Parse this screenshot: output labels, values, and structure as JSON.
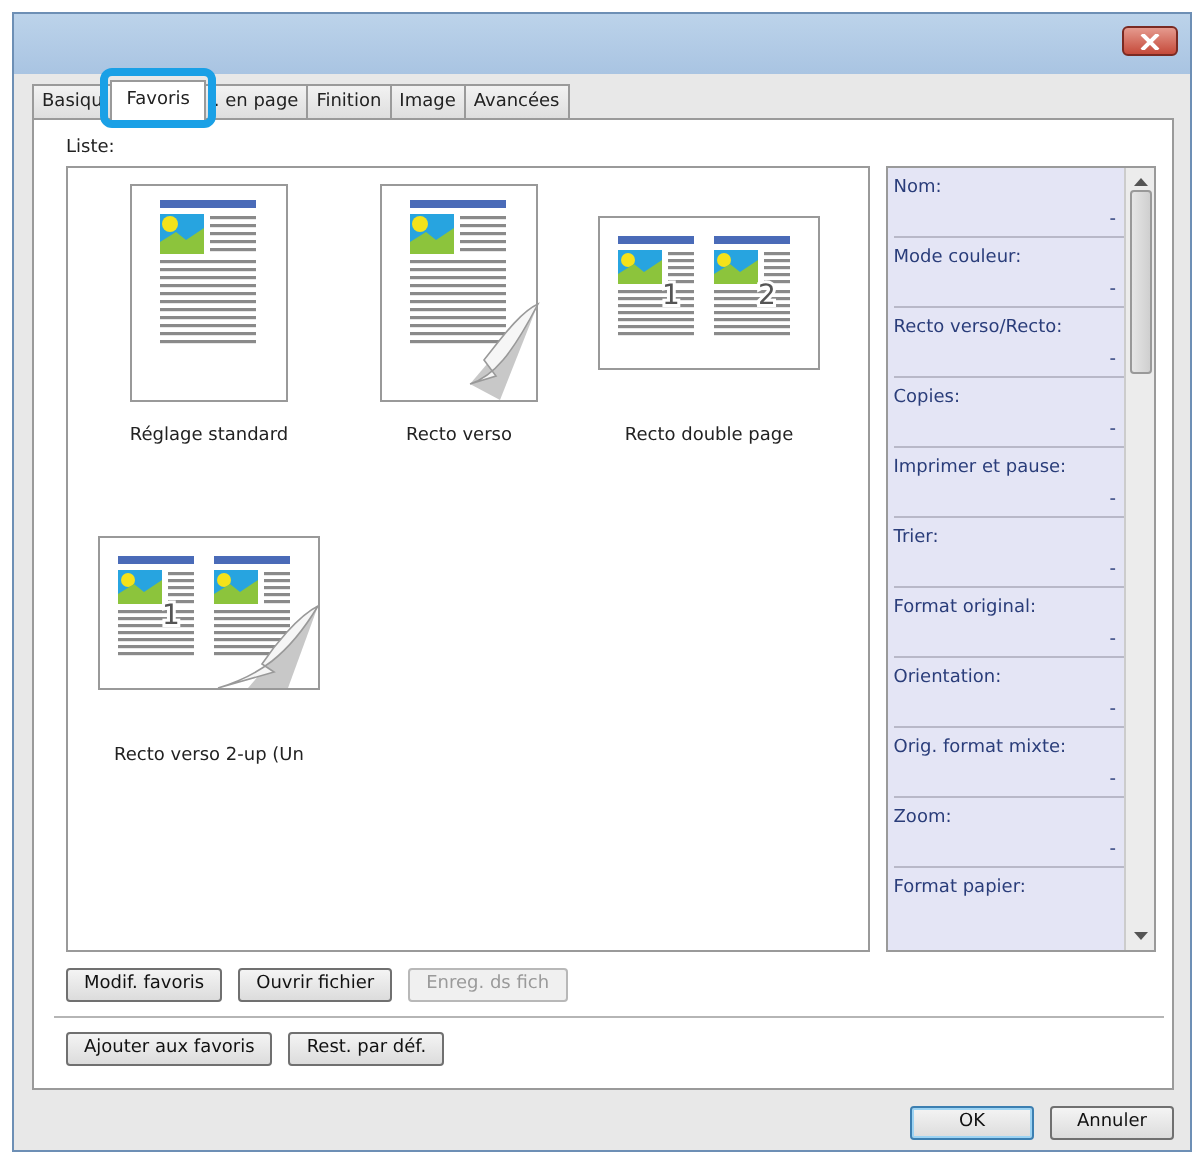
{
  "tabs": [
    {
      "label": "Basiqu",
      "selected": false
    },
    {
      "label": "Favoris",
      "selected": true
    },
    {
      "label": ". en page",
      "selected": false
    },
    {
      "label": "Finition",
      "selected": false
    },
    {
      "label": "Image",
      "selected": false
    },
    {
      "label": "Avancées",
      "selected": false
    }
  ],
  "list_label": "Liste:",
  "favorites": [
    {
      "kind": "single",
      "label": "Réglage standard"
    },
    {
      "kind": "duplex",
      "label": "Recto verso"
    },
    {
      "kind": "booklet",
      "label": "Recto double page",
      "numbers": [
        "1",
        "2"
      ]
    },
    {
      "kind": "duplex_2up",
      "label": "Recto verso 2-up (Un",
      "numbers": [
        "1"
      ]
    }
  ],
  "details": [
    {
      "label": "Nom:",
      "value": "-"
    },
    {
      "label": "Mode couleur:",
      "value": "-"
    },
    {
      "label": "Recto verso/Recto:",
      "value": "-"
    },
    {
      "label": "Copies:",
      "value": "-"
    },
    {
      "label": "Imprimer et pause:",
      "value": "-"
    },
    {
      "label": "Trier:",
      "value": "-"
    },
    {
      "label": "Format original:",
      "value": "-"
    },
    {
      "label": "Orientation:",
      "value": "-"
    },
    {
      "label": "Orig. format mixte:",
      "value": "-"
    },
    {
      "label": "Zoom:",
      "value": "-"
    },
    {
      "label": "Format papier:"
    }
  ],
  "list_buttons": [
    {
      "label": "Modif. favoris",
      "disabled": false
    },
    {
      "label": "Ouvrir fichier",
      "disabled": false
    },
    {
      "label": "Enreg. ds fich",
      "disabled": true
    }
  ],
  "favorite_buttons": [
    {
      "label": "Ajouter aux favoris",
      "disabled": false
    },
    {
      "label": "Rest. par déf.",
      "disabled": false
    }
  ],
  "dialog_buttons": [
    {
      "label": "OK",
      "default": true
    },
    {
      "label": "Annuler",
      "default": false
    }
  ]
}
